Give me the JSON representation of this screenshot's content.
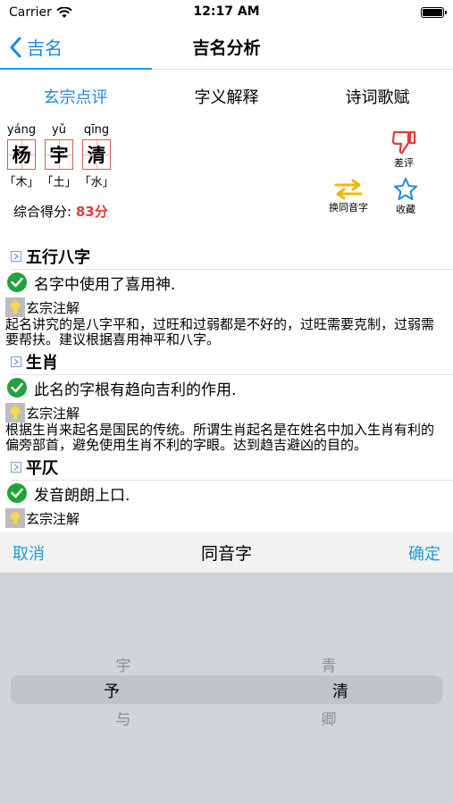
{
  "status": {
    "carrier": "Carrier",
    "time": "12:17 AM"
  },
  "nav": {
    "back_label": "吉名",
    "title": "吉名分析"
  },
  "tabs": [
    {
      "label": "玄宗点评"
    },
    {
      "label": "字义解释"
    },
    {
      "label": "诗词歌赋"
    }
  ],
  "name": {
    "chars": [
      {
        "pinyin": "yáng",
        "char": "杨",
        "element": "「木」"
      },
      {
        "pinyin": "yǔ",
        "char": "宇",
        "element": "「土」"
      },
      {
        "pinyin": "qīng",
        "char": "清",
        "element": "「水」"
      }
    ],
    "score_label": "综合得分:",
    "score_value": "83分"
  },
  "actions": {
    "dislike": "差评",
    "swap": "换同音字",
    "favorite": "收藏"
  },
  "sections": [
    {
      "title": "五行八字",
      "result": "名字中使用了喜用神.",
      "note_label": "玄宗注解",
      "note": "起名讲究的是八字平和，过旺和过弱都是不好的，过旺需要克制，过弱需要帮扶。建议根据喜用神平和八字。"
    },
    {
      "title": "生肖",
      "result": "此名的字根有趋向吉利的作用.",
      "note_label": "玄宗注解",
      "note": "根据生肖来起名是国民的传统。所谓生肖起名是在姓名中加入生肖有利的偏旁部首，避免使用生肖不利的字眼。达到趋吉避凶的目的。"
    },
    {
      "title": "平仄",
      "result": "发音朗朗上口.",
      "note_label": "玄宗注解"
    }
  ],
  "picker": {
    "cancel": "取消",
    "title": "同音字",
    "confirm": "确定",
    "col1": {
      "above": "宇",
      "selected": "予",
      "below": "与"
    },
    "col2": {
      "above": "青",
      "selected": "清",
      "below": "卿"
    }
  },
  "colors": {
    "accent": "#1e88e5",
    "score": "#e53935",
    "check": "#1fa33a",
    "swap": "#f2b705"
  }
}
